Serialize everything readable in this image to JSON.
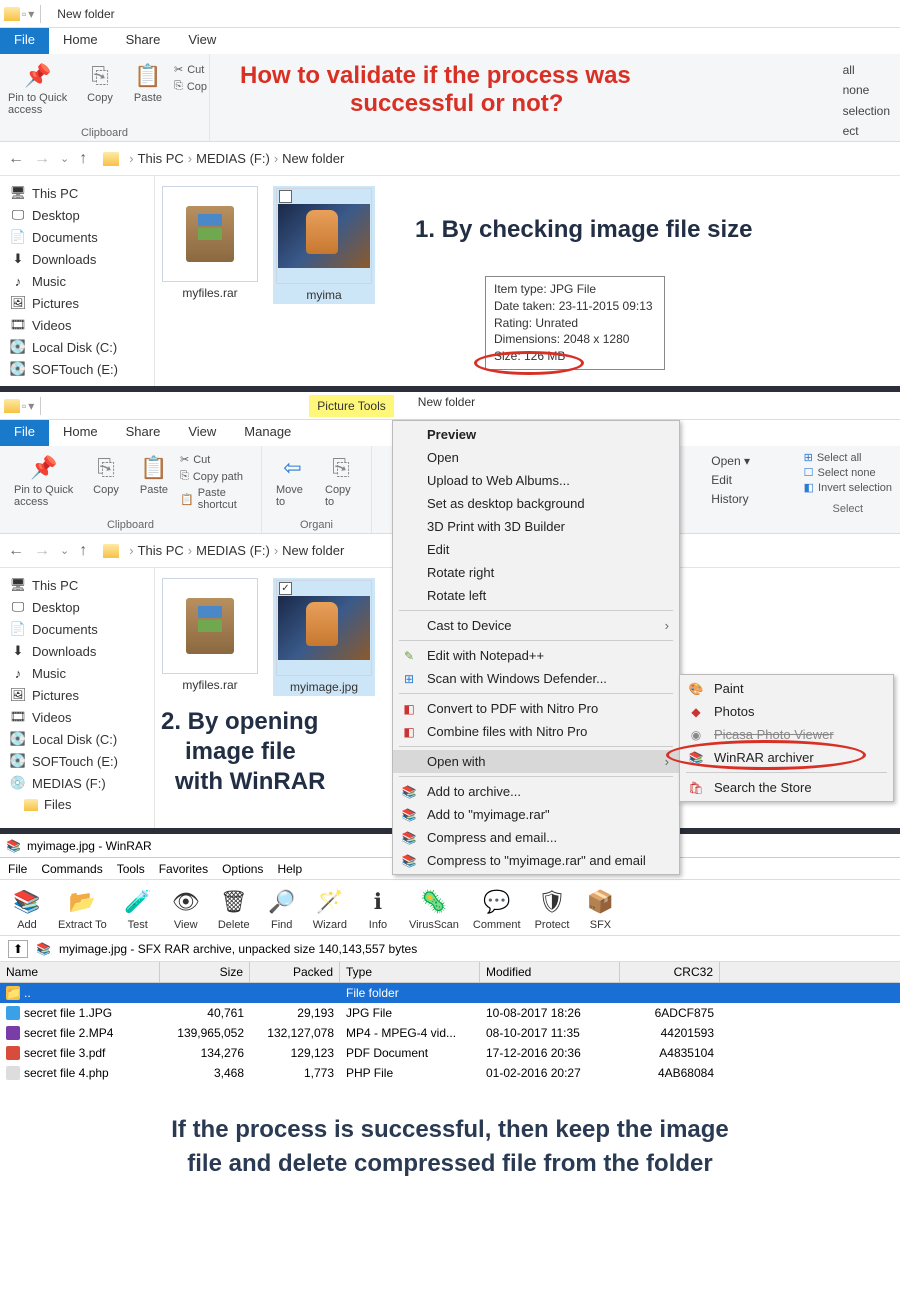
{
  "top": {
    "title": "New folder",
    "tabs": {
      "file": "File",
      "home": "Home",
      "share": "Share",
      "view": "View"
    },
    "ribbon": {
      "pin": "Pin to Quick access",
      "copy": "Copy",
      "paste": "Paste",
      "cut": "Cut",
      "cop": "Cop",
      "clipboard_label": "Clipboard",
      "right1": "all",
      "right2": "none",
      "right3": "selection",
      "right4": "ect"
    },
    "overlay1": "How to validate if  the process was",
    "overlay2": "successful or not?",
    "breadcrumb": {
      "pc": "This PC",
      "disk": "MEDIAS (F:)",
      "folder": "New folder"
    },
    "sidebar": [
      "This PC",
      "Desktop",
      "Documents",
      "Downloads",
      "Music",
      "Pictures",
      "Videos",
      "Local Disk (C:)",
      "SOFTouch (E:)"
    ],
    "files": {
      "rar": "myfiles.rar",
      "img": "myima"
    },
    "tooltip": {
      "type": "Item type: JPG File",
      "date": "Date taken: 23-11-2015 09:13",
      "rating": "Rating: Unrated",
      "dim": "Dimensions: 2048 x 1280",
      "size": "Size: 126 MB"
    },
    "annot": "1. By checking image file size"
  },
  "mid": {
    "picture_tools": "Picture Tools",
    "title": "New folder",
    "tabs": {
      "file": "File",
      "home": "Home",
      "share": "Share",
      "view": "View",
      "manage": "Manage"
    },
    "ribbon": {
      "pin": "Pin to Quick access",
      "copy": "Copy",
      "paste": "Paste",
      "cut": "Cut",
      "copypath": "Copy path",
      "pasteshortcut": "Paste shortcut",
      "clipboard_label": "Clipboard",
      "moveto": "Move to",
      "copyto": "Copy to",
      "organize_label": "Organi",
      "open_d": "Open",
      "edit": "Edit",
      "history": "History",
      "selectall": "Select all",
      "selectnone": "Select none",
      "invert": "Invert selection",
      "select_label": "Select"
    },
    "breadcrumb": {
      "pc": "This PC",
      "disk": "MEDIAS (F:)",
      "folder": "New folder"
    },
    "sidebar": [
      "This PC",
      "Desktop",
      "Documents",
      "Downloads",
      "Music",
      "Pictures",
      "Videos",
      "Local Disk (C:)",
      "SOFTouch (E:)",
      "MEDIAS (F:)",
      "Files"
    ],
    "files": {
      "rar": "myfiles.rar",
      "img": "myimage.jpg"
    },
    "annot1": "2. By opening",
    "annot2": "image file",
    "annot3": "with WinRAR",
    "ctx": {
      "preview": "Preview",
      "open": "Open",
      "upload": "Upload to Web Albums...",
      "setbg": "Set as desktop background",
      "print3d": "3D Print with 3D Builder",
      "edit": "Edit",
      "rotr": "Rotate right",
      "rotl": "Rotate left",
      "cast": "Cast to Device",
      "editnp": "Edit with Notepad++",
      "scan": "Scan with Windows Defender...",
      "pdf": "Convert to PDF with Nitro Pro",
      "combine": "Combine files with Nitro Pro",
      "openwith": "Open with",
      "addarch": "Add to archive...",
      "addrar": "Add to \"myimage.rar\"",
      "compemail": "Compress and email...",
      "comprar": "Compress to \"myimage.rar\" and email"
    },
    "sub": {
      "paint": "Paint",
      "photos": "Photos",
      "viewer": "Picasa Photo Viewer",
      "winrar": "WinRAR archiver",
      "store": "Search the Store"
    }
  },
  "winrar": {
    "title": "myimage.jpg - WinRAR",
    "menu": [
      "File",
      "Commands",
      "Tools",
      "Favorites",
      "Options",
      "Help"
    ],
    "toolbar": [
      "Add",
      "Extract To",
      "Test",
      "View",
      "Delete",
      "Find",
      "Wizard",
      "Info",
      "VirusScan",
      "Comment",
      "Protect",
      "SFX"
    ],
    "path": "myimage.jpg - SFX RAR archive, unpacked size 140,143,557 bytes",
    "headers": {
      "name": "Name",
      "size": "Size",
      "packed": "Packed",
      "type": "Type",
      "mod": "Modified",
      "crc": "CRC32"
    },
    "folder_row": {
      "name": "..",
      "type": "File folder"
    },
    "rows": [
      {
        "name": "secret file 1.JPG",
        "size": "40,761",
        "packed": "29,193",
        "type": "JPG File",
        "mod": "10-08-2017 18:26",
        "crc": "6ADCF875"
      },
      {
        "name": "secret file 2.MP4",
        "size": "139,965,052",
        "packed": "132,127,078",
        "type": "MP4 - MPEG-4 vid...",
        "mod": "08-10-2017 11:35",
        "crc": "44201593"
      },
      {
        "name": "secret file 3.pdf",
        "size": "134,276",
        "packed": "129,123",
        "type": "PDF Document",
        "mod": "17-12-2016 20:36",
        "crc": "A4835104"
      },
      {
        "name": "secret file 4.php",
        "size": "3,468",
        "packed": "1,773",
        "type": "PHP File",
        "mod": "01-02-2016 20:27",
        "crc": "4AB68084"
      }
    ]
  },
  "conclusion1": "If the process is successful, then keep the image",
  "conclusion2": "file and delete compressed file from the folder"
}
